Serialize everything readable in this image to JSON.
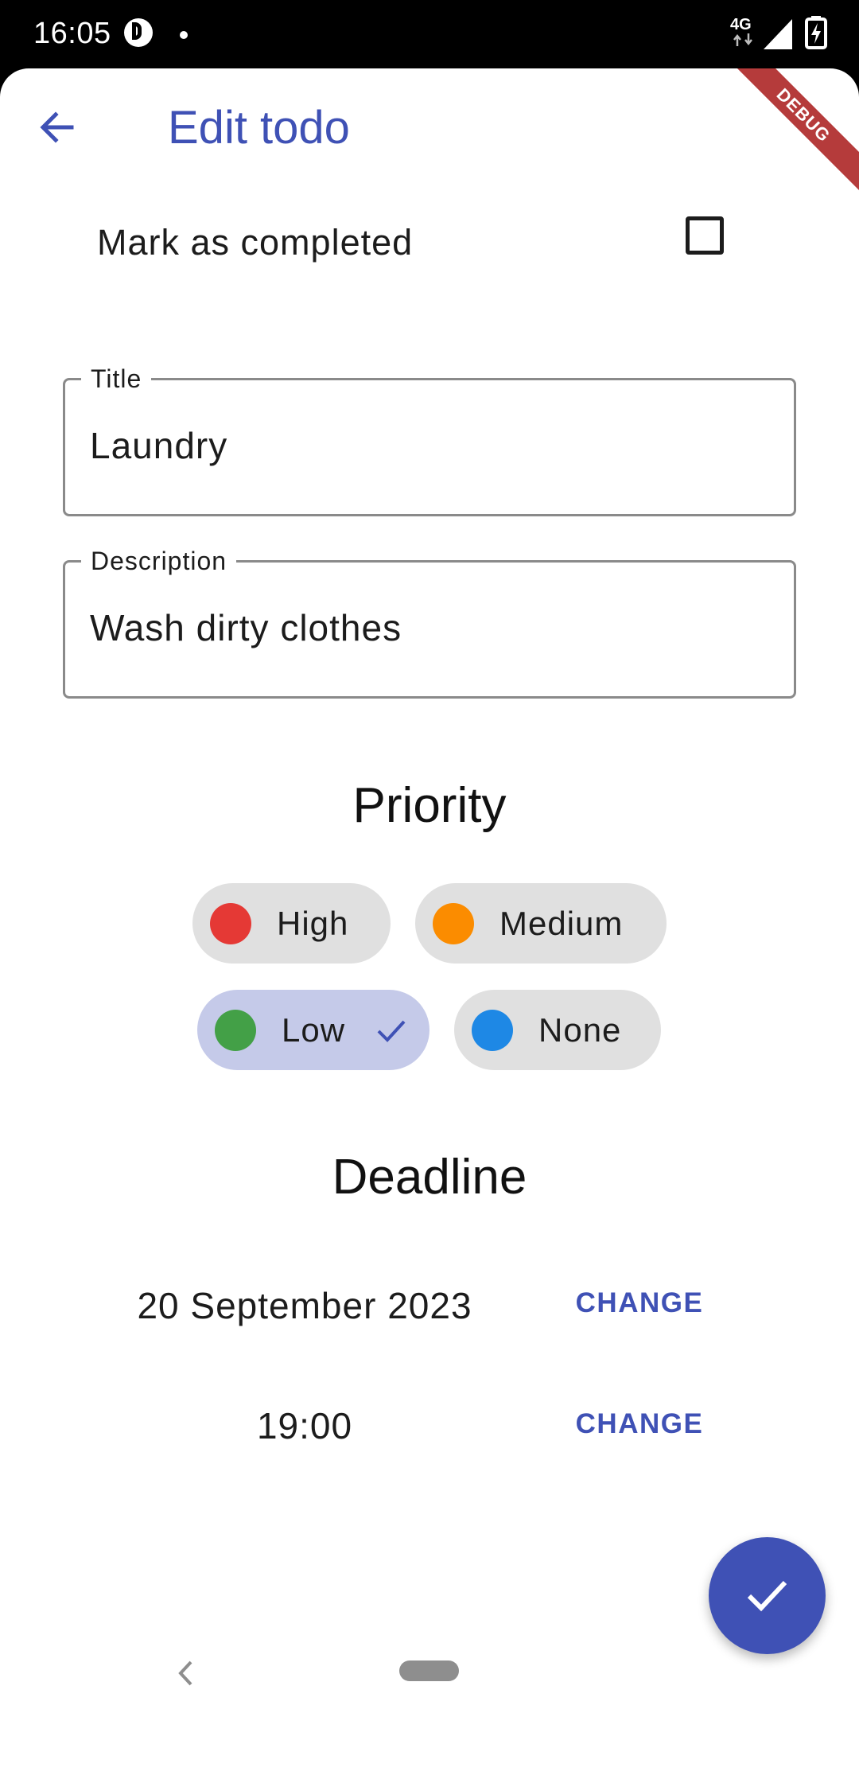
{
  "status_bar": {
    "time": "16:05",
    "network": "4G",
    "icons": [
      "app-notification-icon",
      "dot-icon",
      "network-4g-icon",
      "signal-icon",
      "battery-charging-icon"
    ]
  },
  "app_bar": {
    "title": "Edit todo",
    "back_icon": "arrow-back-icon",
    "debug_banner": "DEBUG"
  },
  "completed": {
    "label": "Mark as completed",
    "checked": false
  },
  "fields": {
    "title": {
      "label": "Title",
      "value": "Laundry"
    },
    "description": {
      "label": "Description",
      "value": "Wash dirty clothes"
    }
  },
  "priority": {
    "heading": "Priority",
    "options": [
      {
        "label": "High",
        "color": "#e53935",
        "selected": false
      },
      {
        "label": "Medium",
        "color": "#fb8c00",
        "selected": false
      },
      {
        "label": "Low",
        "color": "#43a047",
        "selected": true
      },
      {
        "label": "None",
        "color": "#1e88e5",
        "selected": false
      }
    ]
  },
  "deadline": {
    "heading": "Deadline",
    "date": "20 September 2023",
    "time": "19:00",
    "change_label": "CHANGE"
  },
  "fab": {
    "icon": "check-icon"
  },
  "colors": {
    "primary": "#3f51b5",
    "selected_chip": "#c5cae9",
    "chip": "#e0e0e0",
    "debug_banner": "#b53b3b"
  },
  "nav_bar": {
    "icons": [
      "nav-back-icon",
      "nav-home-pill"
    ]
  }
}
